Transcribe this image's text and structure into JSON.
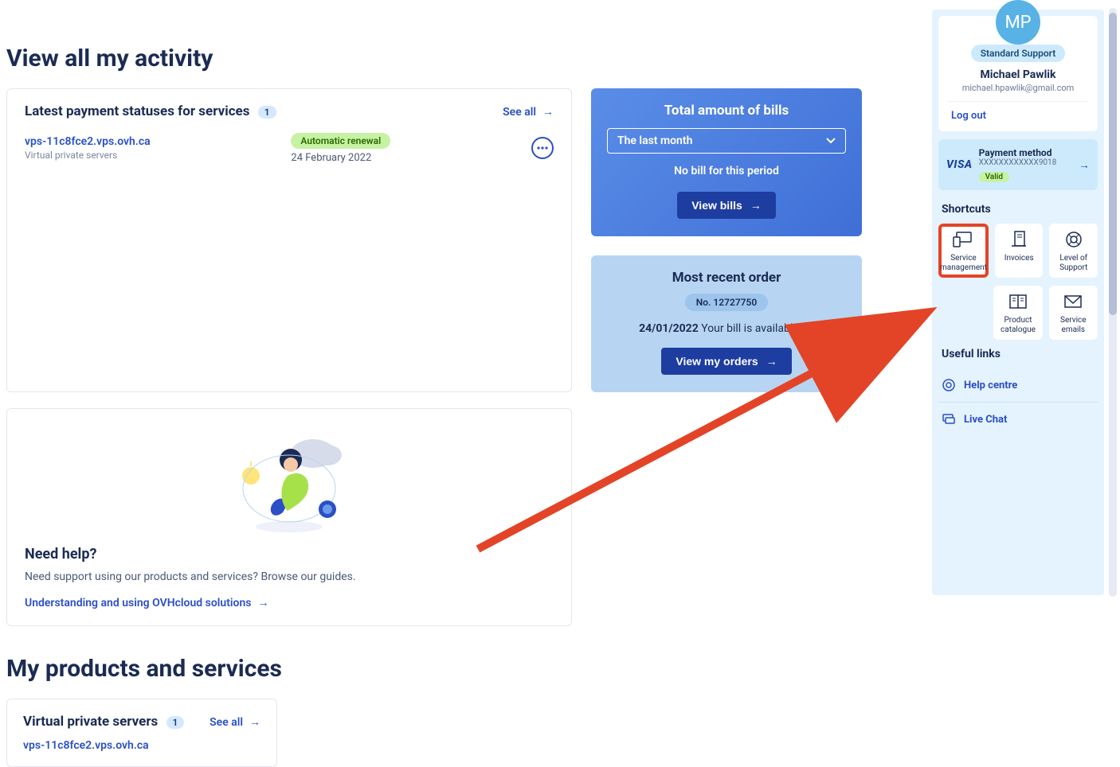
{
  "titles": {
    "activity": "View all my activity",
    "products": "My products and services"
  },
  "latest": {
    "heading": "Latest payment statuses for services",
    "count": "1",
    "see_all": "See all",
    "service_name": "vps-11c8fce2.vps.ovh.ca",
    "service_type": "Virtual private servers",
    "renewal_badge": "Automatic renewal",
    "renewal_date": "24 February 2022"
  },
  "bills": {
    "heading": "Total amount of bills",
    "period_selected": "The last month",
    "no_bill": "No bill for this period",
    "view_btn": "View bills"
  },
  "order": {
    "heading": "Most recent order",
    "number": "No. 12727750",
    "date": "24/01/2022",
    "status_text": "Your bill is available",
    "view_btn": "View my orders"
  },
  "help": {
    "heading": "Need help?",
    "text": "Need support using our products and services? Browse our guides.",
    "link": "Understanding and using OVHcloud solutions"
  },
  "vps": {
    "heading": "Virtual private servers",
    "count": "1",
    "see_all": "See all",
    "item": "vps-11c8fce2.vps.ovh.ca"
  },
  "user": {
    "initials": "MP",
    "support_badge": "Standard Support",
    "name": "Michael Pawlik",
    "email": "michael.hpawlik@gmail.com",
    "logout": "Log out"
  },
  "payment": {
    "brand": "VISA",
    "title": "Payment method",
    "number": "XXXXXXXXXXXX9018",
    "valid": "Valid"
  },
  "shortcuts": {
    "label": "Shortcuts",
    "items": [
      {
        "label": "Service management",
        "highlight": true
      },
      {
        "label": "Invoices"
      },
      {
        "label": "Level of Support"
      },
      {
        "label": "Product catalogue"
      },
      {
        "label": "Service emails"
      }
    ]
  },
  "useful": {
    "label": "Useful links",
    "help_centre": "Help centre",
    "live_chat": "Live Chat"
  }
}
